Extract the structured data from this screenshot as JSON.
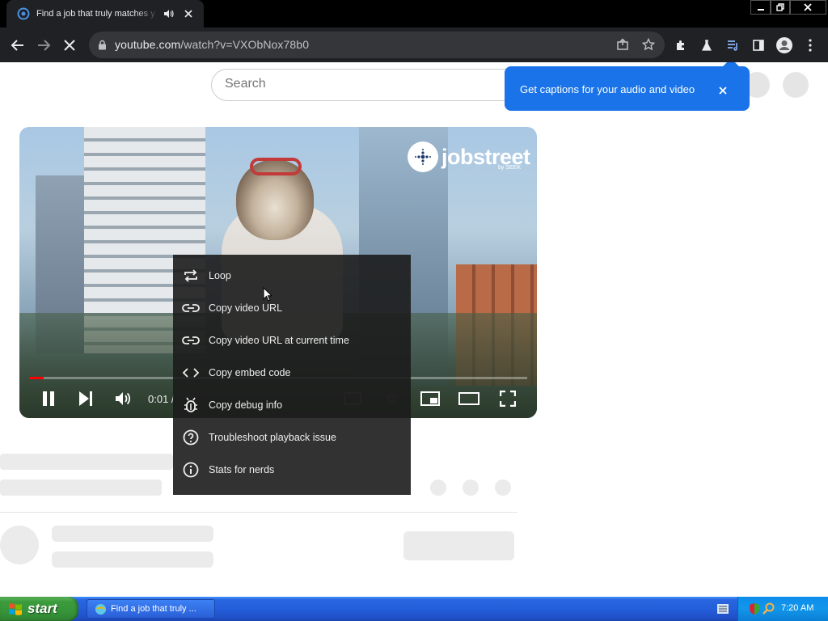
{
  "browser": {
    "tab_title": "Find a job that truly matches y",
    "url_host": "youtube.com",
    "url_path": "/watch?v=VXObNox78b0"
  },
  "page": {
    "search_placeholder": "Search",
    "caption_popup_text": "Get captions for your audio and video"
  },
  "player": {
    "time_display": "0:01 /",
    "progress_fraction": 0.03,
    "brand_text": "jobstreet",
    "brand_sub": "by SEEK"
  },
  "context_menu": {
    "items": [
      {
        "label": "Loop",
        "icon": "loop-icon"
      },
      {
        "label": "Copy video URL",
        "icon": "link-icon"
      },
      {
        "label": "Copy video URL at current time",
        "icon": "link-icon"
      },
      {
        "label": "Copy embed code",
        "icon": "embed-code-icon"
      },
      {
        "label": "Copy debug info",
        "icon": "bug-icon"
      },
      {
        "label": "Troubleshoot playback issue",
        "icon": "help-icon"
      },
      {
        "label": "Stats for nerds",
        "icon": "info-icon"
      }
    ]
  },
  "taskbar": {
    "start_label": "start",
    "task_label": "Find a job that truly ...",
    "clock": "7:20 AM"
  },
  "colors": {
    "caption_blue": "#1a73e8",
    "progress_red": "#ff0000",
    "taskbar_blue": "#245edb",
    "start_green": "#3c9c3c"
  }
}
